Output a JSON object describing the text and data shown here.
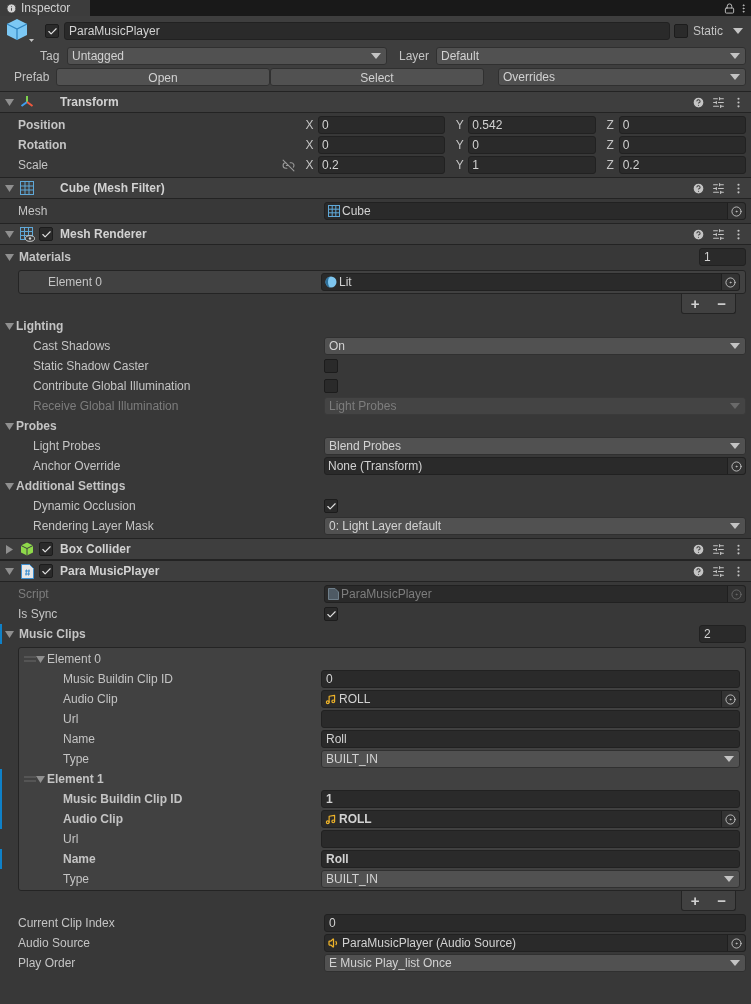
{
  "tab": {
    "title": "Inspector"
  },
  "object": {
    "active": true,
    "name": "ParaMusicPlayer",
    "static": false,
    "static_label": "Static",
    "tag_label": "Tag",
    "tag": "Untagged",
    "layer_label": "Layer",
    "layer": "Default",
    "prefab_label": "Prefab",
    "prefab_buttons": [
      "Open",
      "Select"
    ],
    "overrides": "Overrides"
  },
  "components": [
    {
      "kind": "transform",
      "title": "Transform",
      "expanded": true,
      "rows": [
        {
          "kind": "vector3",
          "label": "Position",
          "bold": true,
          "fields": [
            {
              "axis": "X",
              "value": "0"
            },
            {
              "axis": "Y",
              "value": "0.542"
            },
            {
              "axis": "Z",
              "value": "0"
            }
          ]
        },
        {
          "kind": "vector3",
          "label": "Rotation",
          "bold": true,
          "fields": [
            {
              "axis": "X",
              "value": "0"
            },
            {
              "axis": "Y",
              "value": "0"
            },
            {
              "axis": "Z",
              "value": "0"
            }
          ]
        },
        {
          "kind": "vector3",
          "label": "Scale",
          "bold": false,
          "constrained": false,
          "fields": [
            {
              "axis": "X",
              "value": "0.2"
            },
            {
              "axis": "Y",
              "value": "1"
            },
            {
              "axis": "Z",
              "value": "0.2"
            }
          ]
        }
      ]
    },
    {
      "kind": "meshfilter",
      "title": "Cube (Mesh Filter)",
      "expanded": true,
      "rows": [
        {
          "kind": "mesh",
          "label": "Mesh",
          "value": "Cube"
        }
      ]
    },
    {
      "kind": "meshrenderer",
      "title": "Mesh Renderer",
      "enabled": true,
      "expanded": true,
      "rows": [
        {
          "kind": "list",
          "label": "Materials",
          "expanded": true,
          "count": "1",
          "add": "+",
          "remove": "−",
          "elements": [
            {
              "kind": "material",
              "label": "Element 0",
              "value": "Lit"
            }
          ]
        },
        {
          "kind": "foldout",
          "label": "Lighting",
          "expanded": true,
          "children": [
            {
              "kind": "dropdown",
              "label": "Cast Shadows",
              "value": "On",
              "disabled": false
            },
            {
              "kind": "checkbox",
              "label": "Static Shadow Caster",
              "checked": false,
              "disabled": false
            },
            {
              "kind": "checkbox",
              "label": "Contribute Global Illumination",
              "checked": false,
              "disabled": false
            },
            {
              "kind": "dropdown",
              "label": "Receive Global Illumination",
              "value": "Light Probes",
              "disabled": true
            }
          ]
        },
        {
          "kind": "foldout",
          "label": "Probes",
          "expanded": true,
          "children": [
            {
              "kind": "dropdown",
              "label": "Light Probes",
              "value": "Blend Probes"
            },
            {
              "kind": "object",
              "label": "Anchor Override",
              "value": "None (Transform)"
            }
          ]
        },
        {
          "kind": "foldout",
          "label": "Additional Settings",
          "expanded": true,
          "children": [
            {
              "kind": "checkbox",
              "label": "Dynamic Occlusion",
              "checked": true
            },
            {
              "kind": "dropdown",
              "label": "Rendering Layer Mask",
              "value": "0: Light Layer default"
            }
          ]
        }
      ]
    },
    {
      "kind": "boxcollider",
      "title": "Box Collider",
      "enabled": true,
      "expanded": false
    },
    {
      "kind": "script",
      "title": "Para MusicPlayer",
      "enabled": true,
      "expanded": true,
      "rows": [
        {
          "kind": "script",
          "label": "Script",
          "value": "ParaMusicPlayer",
          "disabled": true,
          "overridden": false
        },
        {
          "kind": "checkbox",
          "label": "Is Sync",
          "checked": true,
          "disabled": false,
          "overridden": false
        },
        {
          "kind": "list",
          "label": "Music Clips",
          "expanded": true,
          "overridden": true,
          "disabled": false,
          "count": "2",
          "add": "+",
          "remove": "−",
          "elements": [
            {
              "kind": "foldout",
              "label": "Element 0",
              "expanded": true,
              "overridden": false,
              "children": [
                {
                  "kind": "text",
                  "label": "Music Buildin Clip ID",
                  "value": "0",
                  "overridden": false
                },
                {
                  "kind": "audio",
                  "label": "Audio Clip",
                  "value": "ROLL",
                  "overridden": false
                },
                {
                  "kind": "text",
                  "label": "Url",
                  "overridden": false
                },
                {
                  "kind": "text",
                  "label": "Name",
                  "value": "Roll",
                  "overridden": false
                },
                {
                  "kind": "dropdown",
                  "label": "Type",
                  "value": "BUILT_IN",
                  "overridden": false
                }
              ]
            },
            {
              "kind": "foldout",
              "label": "Element 1",
              "expanded": true,
              "overridden": true,
              "children": [
                {
                  "kind": "text",
                  "label": "Music Buildin Clip ID",
                  "value": "1",
                  "overridden": true
                },
                {
                  "kind": "audio",
                  "label": "Audio Clip",
                  "value": "ROLL",
                  "overridden": true
                },
                {
                  "kind": "text",
                  "label": "Url",
                  "overridden": false
                },
                {
                  "kind": "text",
                  "label": "Name",
                  "value": "Roll",
                  "overridden": true
                },
                {
                  "kind": "dropdown",
                  "label": "Type",
                  "value": "BUILT_IN",
                  "overridden": false
                }
              ]
            }
          ]
        },
        {
          "kind": "text",
          "label": "Current Clip Index",
          "value": "0",
          "disabled": false,
          "overridden": false
        },
        {
          "kind": "audiosource",
          "label": "Audio Source",
          "value": "ParaMusicPlayer (Audio Source)",
          "disabled": false,
          "overridden": false
        },
        {
          "kind": "dropdown",
          "label": "Play Order",
          "value": "E Music Play_list Once",
          "disabled": false,
          "overridden": false
        }
      ]
    }
  ]
}
